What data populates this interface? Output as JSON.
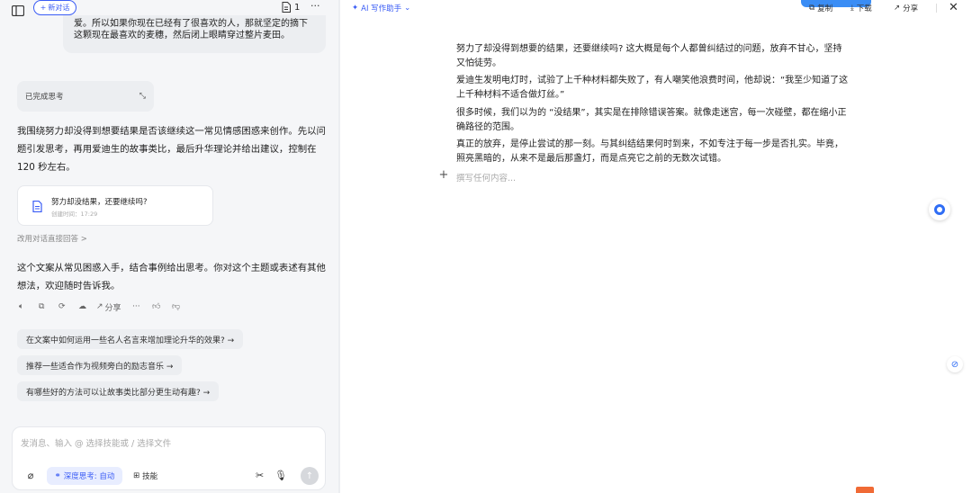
{
  "top_left": {
    "new_chat": "新对话",
    "page_count": "1",
    "more": "···"
  },
  "quote": {
    "line1": "爱。所以如果你现在已经有了很喜欢的人，那就坚定的摘下",
    "line2": "这颗现在最喜欢的麦穗，然后闭上眼睛穿过整片麦田。"
  },
  "thinking": {
    "label": "已完成思考"
  },
  "reply1": {
    "line1": "我围绕努力却没得到想要结果是否该继续这一常见情感困惑来创作。先以问",
    "line2": "题引发思考，再用爱迪生的故事类比，最后升华理论并给出建议，控制在",
    "line3": "120 秒左右。"
  },
  "doc_card": {
    "title": "努力却没结果，还要继续吗?",
    "time": "创建时间：17:29"
  },
  "switch_link": "改用对话直接回答 >",
  "reply2": {
    "line1": "这个文案从常见困惑入手，结合事例给出思考。你对这个主题或表述有其他",
    "line2": "想法，欢迎随时告诉我。"
  },
  "actions": {
    "share": "分享",
    "more": "···"
  },
  "suggestions": [
    "在文案中如何运用一些名人名言来增加理论升华的效果? →",
    "推荐一些适合作为视频旁白的励志音乐 →",
    "有哪些好的方法可以让故事类比部分更生动有趣? →"
  ],
  "input": {
    "placeholder": "发消息、输入 @ 选择技能或 / 选择文件",
    "deep_think": "深度思考: 自动",
    "skills": "技能"
  },
  "editor": {
    "ai_assistant": "AI 写作助手",
    "copy": "复制",
    "download": "下载",
    "share": "分享",
    "placeholder": "撰写任何内容..."
  },
  "doc": {
    "p1a": "努力了却没得到想要的结果，还要继续吗? 这大概是每个人都曾纠结过的问题，放弃不甘心，坚持",
    "p1b": "又怕徒劳。",
    "p2a": "爱迪生发明电灯时，试验了上千种材料都失败了，有人嘲笑他浪费时间，他却说：“我至少知道了这",
    "p2b": "上千种材料不适合做灯丝。”",
    "p3a": "很多时候，我们以为的 “没结果”，其实是在排除错误答案。就像走迷宫，每一次碰壁，都在缩小正",
    "p3b": "确路径的范围。",
    "p4a": "真正的放弃，是停止尝试的那一刻。与其纠结结果何时到来，不如专注于每一步是否扎实。毕竟，",
    "p4b": "照亮黑暗的，从来不是最后那盏灯，而是点亮它之前的无数次试错。"
  },
  "colors": {
    "accent": "#3a5cf5",
    "left_bg": "#f5f6f8"
  }
}
